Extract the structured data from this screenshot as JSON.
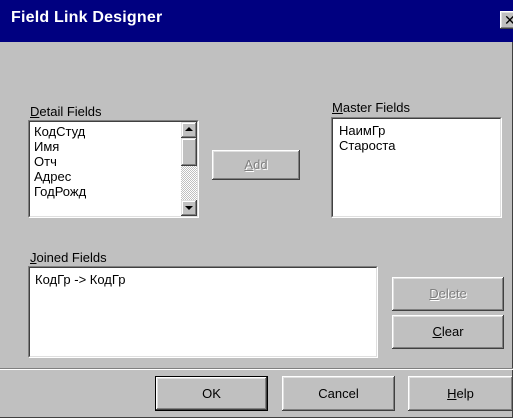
{
  "window": {
    "title": "Field Link Designer",
    "close_glyph": "✕"
  },
  "detail_fields": {
    "label_hotkey": "D",
    "label_rest": "etail Fields",
    "items": [
      "КодСтуд",
      "Имя",
      "Отч",
      "Адрес",
      "ГодРожд"
    ]
  },
  "master_fields": {
    "label_hotkey": "M",
    "label_rest": "aster Fields",
    "items": [
      "НаимГр",
      "Староста"
    ]
  },
  "joined_fields": {
    "label_hotkey": "J",
    "label_rest": "oined Fields",
    "items": [
      "КодГр -> КодГр"
    ]
  },
  "buttons": {
    "add_hotkey": "A",
    "add_rest": "dd",
    "delete_hotkey": "D",
    "delete_rest": "elete",
    "clear_hotkey": "C",
    "clear_rest": "lear",
    "ok": "OK",
    "cancel": "Cancel",
    "help_hotkey": "H",
    "help_rest": "elp"
  },
  "colors": {
    "titlebar": "#000080",
    "face": "#c0c0c0",
    "disabled_text": "#808080"
  }
}
